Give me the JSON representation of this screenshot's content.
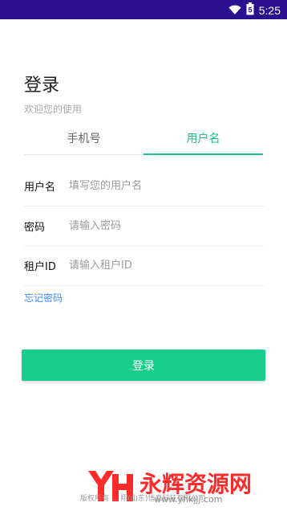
{
  "status_bar": {
    "time": "5:25",
    "battery": "5"
  },
  "login": {
    "title": "登录",
    "subtitle": "欢迎您的使用",
    "tabs": [
      {
        "label": "手机号"
      },
      {
        "label": "用户名"
      }
    ],
    "fields": [
      {
        "label": "用户名",
        "placeholder": "填写您的用户名",
        "value": ""
      },
      {
        "label": "密码",
        "placeholder": "请输入密码",
        "value": ""
      },
      {
        "label": "租户ID",
        "placeholder": "请输入租户ID",
        "value": ""
      }
    ],
    "forgot_password": "忘记密码",
    "submit_label": "登录"
  },
  "watermark": {
    "brand": "永辉资源网",
    "url": "www.yhkjjj.com",
    "copyright": "版权所有 ... 翔(山东)信息科技有限公司"
  },
  "colors": {
    "status_bar": "#2a0f8f",
    "accent": "#17cd8b",
    "link": "#3a89ff",
    "watermark": "#ff2a2a"
  }
}
